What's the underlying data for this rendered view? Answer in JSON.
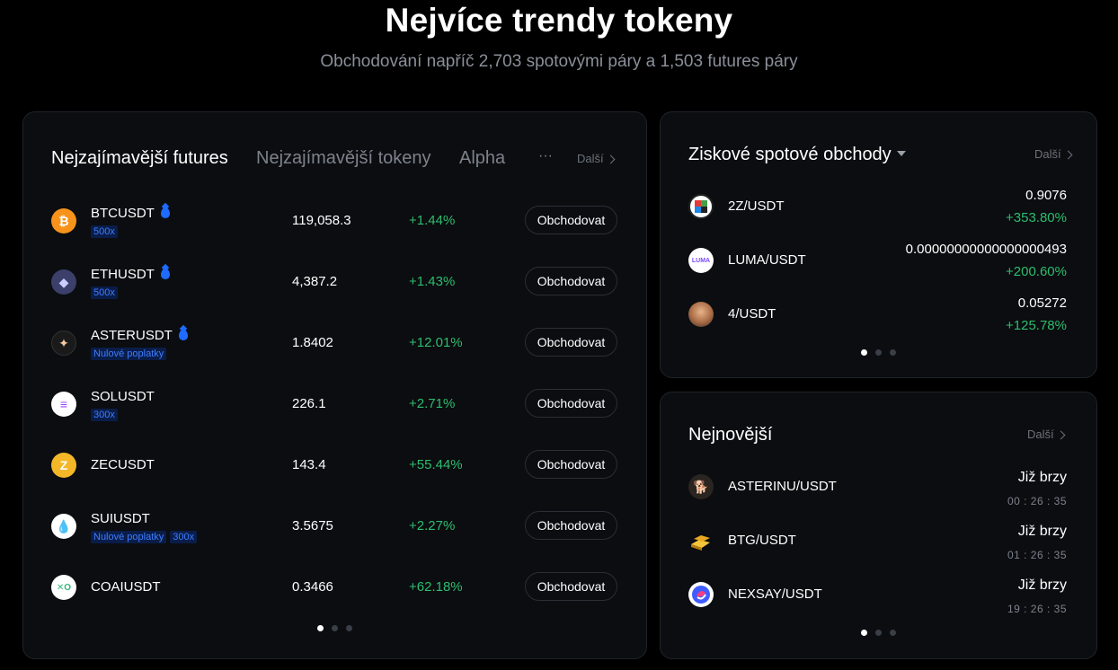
{
  "hero": {
    "title": "Nejvíce trendy tokeny",
    "subtitle": "Obchodování napříč 2,703 spotovými páry a 1,503 futures páry"
  },
  "futures": {
    "tabs": [
      "Nejzajímavější futures",
      "Nejzajímavější tokeny",
      "Alpha"
    ],
    "more_tabs": "···",
    "more_label": "Další",
    "trade_label": "Obchodovat",
    "rows": [
      {
        "symbol": "BTCUSDT",
        "tags": [
          "500x"
        ],
        "price": "119,058.3",
        "change": "+1.44%",
        "icon": "bitcoin-icon",
        "color": "#f7931a"
      },
      {
        "symbol": "ETHUSDT",
        "tags": [
          "500x"
        ],
        "price": "4,387.2",
        "change": "+1.43%",
        "icon": "ethereum-icon",
        "color": "#3c3c5c"
      },
      {
        "symbol": "ASTERUSDT",
        "tags": [
          "Nulové poplatky"
        ],
        "price": "1.8402",
        "change": "+12.01%",
        "icon": "aster-icon",
        "color": "#1a1a1a"
      },
      {
        "symbol": "SOLUSDT",
        "tags": [
          "300x"
        ],
        "price": "226.1",
        "change": "+2.71%",
        "icon": "solana-icon",
        "color": "#ffffff"
      },
      {
        "symbol": "ZECUSDT",
        "tags": [],
        "price": "143.4",
        "change": "+55.44%",
        "icon": "zcash-icon",
        "color": "#f4b728"
      },
      {
        "symbol": "SUIUSDT",
        "tags": [
          "Nulové poplatky",
          "300x"
        ],
        "price": "3.5675",
        "change": "+2.27%",
        "icon": "sui-icon",
        "color": "#ffffff"
      },
      {
        "symbol": "COAIUSDT",
        "tags": [],
        "price": "0.3466",
        "change": "+62.18%",
        "icon": "coai-icon",
        "color": "#ffffff"
      }
    ]
  },
  "gainers": {
    "title": "Ziskové spotové obchody",
    "more_label": "Další",
    "rows": [
      {
        "pair": "2Z/USDT",
        "value": "0.9076",
        "change": "+353.80%",
        "icon": "2z-icon"
      },
      {
        "pair": "LUMA/USDT",
        "value": "0.00000000000000000493",
        "change": "+200.60%",
        "icon": "luma-icon",
        "logo_text": "LUMA"
      },
      {
        "pair": "4/USDT",
        "value": "0.05272",
        "change": "+125.78%",
        "icon": "4-icon"
      }
    ]
  },
  "newest": {
    "title": "Nejnovější",
    "more_label": "Další",
    "rows": [
      {
        "pair": "ASTERINU/USDT",
        "status": "Již brzy",
        "countdown": "00 : 26 : 35",
        "icon": "asterinu-icon"
      },
      {
        "pair": "BTG/USDT",
        "status": "Již brzy",
        "countdown": "01 : 26 : 35",
        "icon": "btg-icon"
      },
      {
        "pair": "NEXSAY/USDT",
        "status": "Již brzy",
        "countdown": "19 : 26 : 35",
        "icon": "nexsay-icon"
      }
    ]
  }
}
